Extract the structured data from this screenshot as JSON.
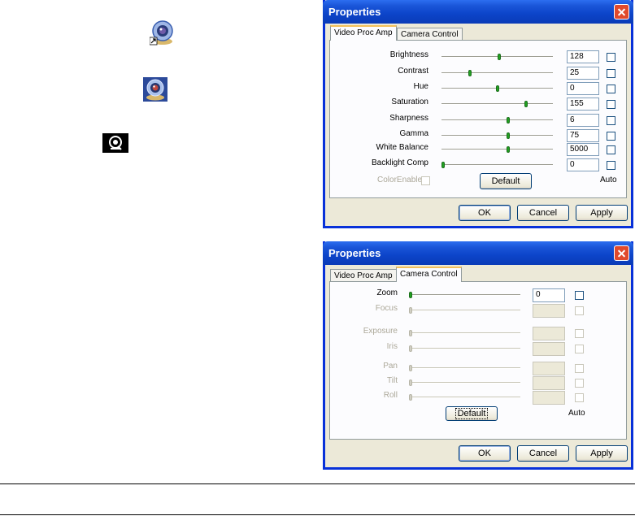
{
  "dialog1": {
    "title": "Properties",
    "tabs": [
      {
        "label": "Video Proc Amp",
        "active": true
      },
      {
        "label": "Camera Control",
        "active": false
      }
    ],
    "rows": [
      {
        "label": "Brightness",
        "value": "128",
        "level": 0.52
      },
      {
        "label": "Contrast",
        "value": "25",
        "level": 0.25
      },
      {
        "label": "Hue",
        "value": "0",
        "level": 0.5
      },
      {
        "label": "Saturation",
        "value": "155",
        "level": 0.77
      },
      {
        "label": "Sharpness",
        "value": "6",
        "level": 0.6
      },
      {
        "label": "Gamma",
        "value": "75",
        "level": 0.6
      },
      {
        "label": "White Balance",
        "value": "5000",
        "level": 0.6
      },
      {
        "label": "Backlight Comp",
        "value": "0",
        "level": 0.0
      }
    ],
    "color_enable_label": "ColorEnable",
    "default_label": "Default",
    "auto_label": "Auto",
    "ok_label": "OK",
    "cancel_label": "Cancel",
    "apply_label": "Apply"
  },
  "dialog2": {
    "title": "Properties",
    "tabs": [
      {
        "label": "Video Proc Amp",
        "active": false
      },
      {
        "label": "Camera Control",
        "active": true
      }
    ],
    "rows": [
      {
        "label": "Zoom",
        "value": "0",
        "enabled": true
      },
      {
        "label": "Focus",
        "value": "",
        "enabled": false
      },
      {
        "label": "Exposure",
        "value": "",
        "enabled": false
      },
      {
        "label": "Iris",
        "value": "",
        "enabled": false
      },
      {
        "label": "Pan",
        "value": "",
        "enabled": false
      },
      {
        "label": "Tilt",
        "value": "",
        "enabled": false
      },
      {
        "label": "Roll",
        "value": "",
        "enabled": false
      }
    ],
    "default_label": "Default",
    "auto_label": "Auto",
    "ok_label": "OK",
    "cancel_label": "Cancel",
    "apply_label": "Apply"
  },
  "icons": [
    "webcam-shortcut-icon",
    "webcam-app-icon",
    "webcam-tray-icon"
  ]
}
